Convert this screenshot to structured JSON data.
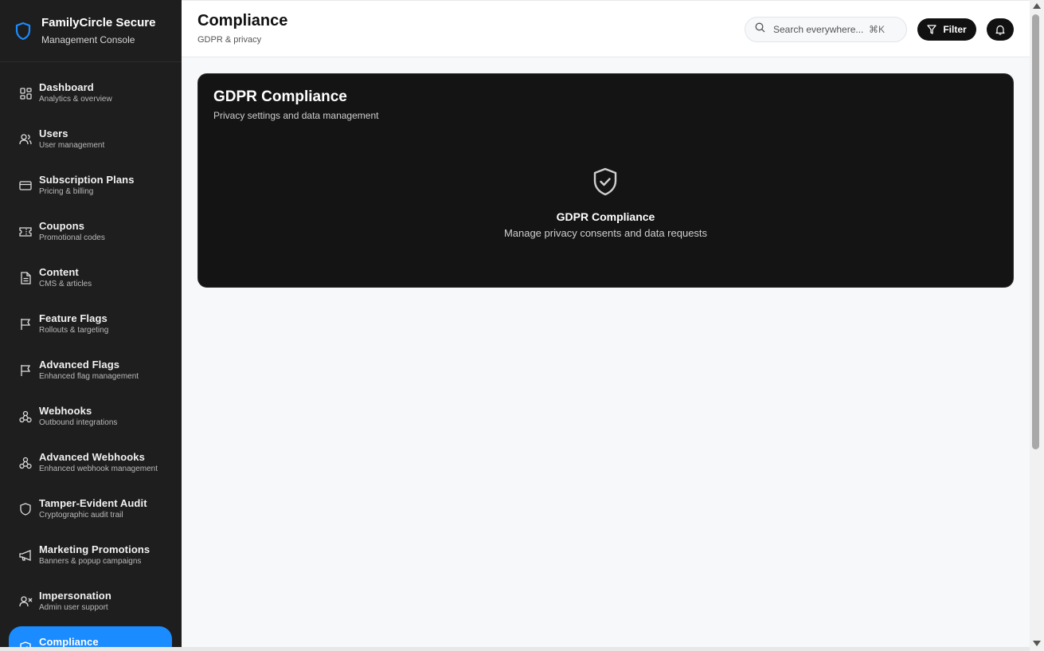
{
  "brand": {
    "title": "FamilyCircle Secure",
    "subtitle": "Management Console",
    "accent": "#1b8cff"
  },
  "sidebar": {
    "items": [
      {
        "label": "Dashboard",
        "sub": "Analytics & overview",
        "icon": "dashboard-icon"
      },
      {
        "label": "Users",
        "sub": "User management",
        "icon": "users-icon"
      },
      {
        "label": "Subscription Plans",
        "sub": "Pricing & billing",
        "icon": "credit-card-icon"
      },
      {
        "label": "Coupons",
        "sub": "Promotional codes",
        "icon": "ticket-icon"
      },
      {
        "label": "Content",
        "sub": "CMS & articles",
        "icon": "document-icon"
      },
      {
        "label": "Feature Flags",
        "sub": "Rollouts & targeting",
        "icon": "flag-icon"
      },
      {
        "label": "Advanced Flags",
        "sub": "Enhanced flag management",
        "icon": "flag-icon"
      },
      {
        "label": "Webhooks",
        "sub": "Outbound integrations",
        "icon": "webhook-icon"
      },
      {
        "label": "Advanced Webhooks",
        "sub": "Enhanced webhook management",
        "icon": "webhook-icon"
      },
      {
        "label": "Tamper-Evident Audit",
        "sub": "Cryptographic audit trail",
        "icon": "shield-icon"
      },
      {
        "label": "Marketing Promotions",
        "sub": "Banners & popup campaigns",
        "icon": "megaphone-icon"
      },
      {
        "label": "Impersonation",
        "sub": "Admin user support",
        "icon": "user-x-icon"
      },
      {
        "label": "Compliance",
        "sub": "",
        "icon": "shield-check-icon",
        "active": true
      }
    ]
  },
  "header": {
    "title": "Compliance",
    "subtitle": "GDPR & privacy",
    "search_placeholder": "Search everywhere...",
    "search_shortcut": "⌘K",
    "filter_label": "Filter"
  },
  "card": {
    "title": "GDPR Compliance",
    "subtitle": "Privacy settings and data management",
    "empty_title": "GDPR Compliance",
    "empty_subtitle": "Manage privacy consents and data requests"
  }
}
